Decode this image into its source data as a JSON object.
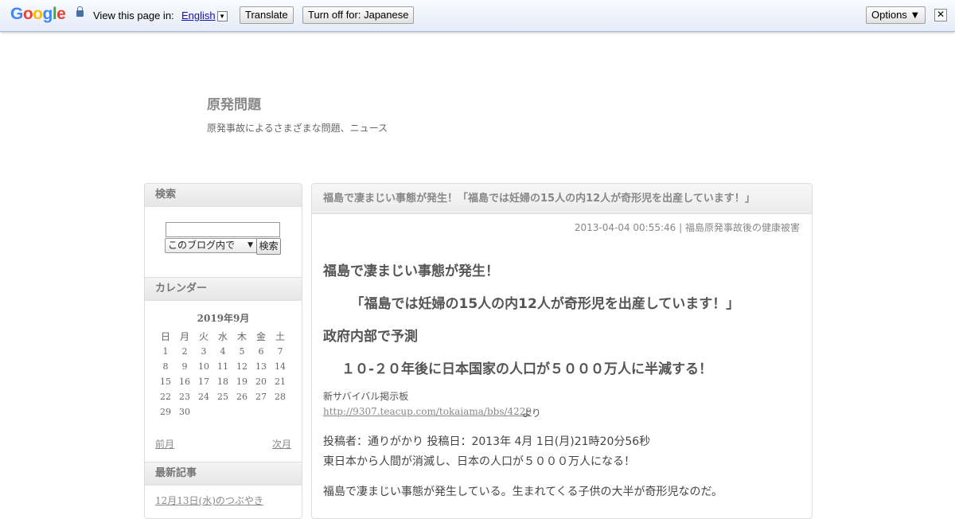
{
  "translate_bar": {
    "logo_letters": [
      {
        "ch": "G",
        "color": "#4285f4"
      },
      {
        "ch": "o",
        "color": "#ea4335"
      },
      {
        "ch": "o",
        "color": "#fbbc05"
      },
      {
        "ch": "g",
        "color": "#4285f4"
      },
      {
        "ch": "l",
        "color": "#34a853"
      },
      {
        "ch": "e",
        "color": "#ea4335"
      }
    ],
    "view_in_label": "View this page in:",
    "language": "English",
    "translate_button": "Translate",
    "turn_off_button": "Turn off for: Japanese",
    "options_button": "Options ▼",
    "close_glyph": "✕"
  },
  "blog": {
    "title": "原発問題",
    "description": "原発事故によるさまざまな問題、ニュース"
  },
  "sidebar": {
    "search": {
      "heading": "検索",
      "input_value": "",
      "scope_option": "このブログ内で",
      "button": "検索"
    },
    "calendar": {
      "heading": "カレンダー",
      "month": "2019年9月",
      "weekdays": [
        "日",
        "月",
        "火",
        "水",
        "木",
        "金",
        "土"
      ],
      "weeks": [
        [
          "1",
          "2",
          "3",
          "4",
          "5",
          "6",
          "7"
        ],
        [
          "8",
          "9",
          "10",
          "11",
          "12",
          "13",
          "14"
        ],
        [
          "15",
          "16",
          "17",
          "18",
          "19",
          "20",
          "21"
        ],
        [
          "22",
          "23",
          "24",
          "25",
          "26",
          "27",
          "28"
        ],
        [
          "29",
          "30",
          "",
          "",
          "",
          "",
          ""
        ]
      ],
      "prev": "前月",
      "next": "次月"
    },
    "recent": {
      "heading": "最新記事",
      "items": [
        "12月13日(水)のつぶやき"
      ]
    }
  },
  "article": {
    "title": "福島で凄まじい事態が発生！「福島では妊婦の15人の内12人が奇形児を出産しています！」",
    "date": "2013-04-04 00:55:46",
    "separator": " | ",
    "category": "福島原発事故後の健康被害",
    "headlines": [
      "福島で凄まじい事態が発生！",
      "　「福島では妊婦の15人の内12人が奇形児を出産しています！」",
      "政府内部で予測",
      "　１０-２０年後に日本国家の人口が５０００万人に半減する！"
    ],
    "source_label": "新サバイバル掲示板",
    "source_link": "http://9307.teacup.com/tokaiama/bbs/4229",
    "source_suffix": "より",
    "post_lines": [
      "投稿者：通りがかり  投稿日：2013年 4月 1日(月)21時20分56秒",
      "  東日本から人間が消滅し、日本の人口が５０００万人になる！",
      "福島で凄まじい事態が発生している。生まれてくる子供の大半が奇形児なのだ。"
    ]
  }
}
